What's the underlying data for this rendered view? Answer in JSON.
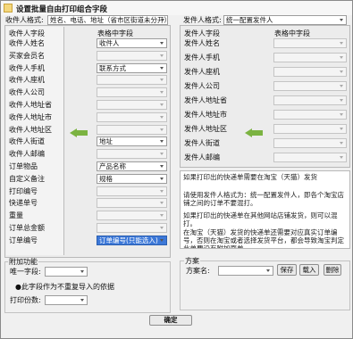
{
  "window": {
    "title": "设置批量自由打印组合字段"
  },
  "recipient": {
    "format_label": "收件人格式:",
    "format_value": "姓名、电话、地址（省市区街道未分开）",
    "col_header_fields": "收件人字段",
    "col_header_table": "表格中字段",
    "rows": [
      {
        "label": "收件人姓名",
        "value": "收件人"
      },
      {
        "label": "买家会员名",
        "value": ""
      },
      {
        "label": "收件人手机",
        "value": "联系方式"
      },
      {
        "label": "收件人座机",
        "value": ""
      },
      {
        "label": "收件人公司",
        "value": ""
      },
      {
        "label": "收件人地址省",
        "value": ""
      },
      {
        "label": "收件人地址市",
        "value": ""
      },
      {
        "label": "收件人地址区",
        "value": ""
      },
      {
        "label": "收件人街道",
        "value": "地址"
      },
      {
        "label": "收件人邮编",
        "value": ""
      },
      {
        "label": "订单物品",
        "value": "产品名称"
      },
      {
        "label": "自定义备注",
        "value": "规格"
      },
      {
        "label": "打印编号",
        "value": ""
      },
      {
        "label": "快递单号",
        "value": ""
      },
      {
        "label": "重量",
        "value": ""
      },
      {
        "label": "订单总金额",
        "value": ""
      },
      {
        "label": "订单编号",
        "value": "订单编号(只能选入)"
      }
    ]
  },
  "sender": {
    "format_label": "发件人格式:",
    "format_value": "统一配置发件人",
    "col_header_fields": "发件人字段",
    "col_header_table": "表格中字段",
    "rows": [
      {
        "label": "发件人姓名",
        "value": ""
      },
      {
        "label": "发件人手机",
        "value": ""
      },
      {
        "label": "发件人座机",
        "value": ""
      },
      {
        "label": "发件人公司",
        "value": ""
      },
      {
        "label": "发件人地址省",
        "value": ""
      },
      {
        "label": "发件人地址市",
        "value": ""
      },
      {
        "label": "发件人地址区",
        "value": ""
      },
      {
        "label": "发件人街道",
        "value": ""
      },
      {
        "label": "发件人邮编",
        "value": ""
      }
    ]
  },
  "info": {
    "line1": "如果打印出的快递单需要在淘宝（天猫）发货",
    "line2": "请使用发件人格式为：统一配置发件人，即各个淘宝店铺之间的订单不要混打。",
    "line3": "如果打印出的快递单在其他网站店铺发货，则可以混打。",
    "line4": "在淘宝（天猫）发货的快递单还需要对应真实订单编号，否则在淘宝或者选择发货平台，都会导致淘宝判定此单要没有附加面单。"
  },
  "extra": {
    "group_label": "附加功能",
    "unique_field_label": "唯一字段:",
    "unique_field_value": "",
    "unique_note": "●此字段作为不重复导入的依据",
    "print_count_label": "打印份数:",
    "print_count_value": ""
  },
  "scheme": {
    "group_label": "方案",
    "name_label": "方案名:",
    "name_value": "",
    "save_label": "保存",
    "load_label": "载入",
    "delete_label": "删除"
  },
  "footer": {
    "ok_label": "确定"
  },
  "colors": {
    "arrow": "#7bb341",
    "selected": "#3c78d8"
  }
}
